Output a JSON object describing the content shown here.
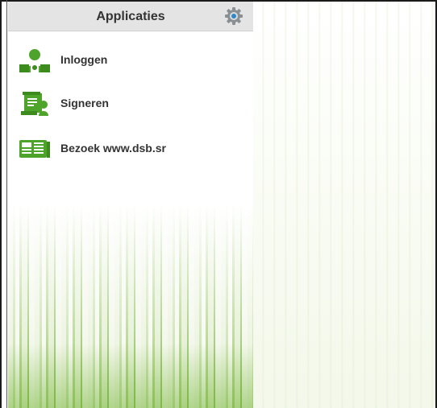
{
  "header": {
    "title": "Applicaties",
    "settings_icon": "gear-icon"
  },
  "menu": {
    "items": [
      {
        "label": "Inloggen",
        "icon": "user-login-icon"
      },
      {
        "label": "Signeren",
        "icon": "sign-document-icon"
      },
      {
        "label": "Bezoek www.dsb.sr",
        "icon": "newspaper-icon"
      }
    ]
  },
  "colors": {
    "accent": "#4ea32a",
    "header_bg": "#e4e4e4",
    "text": "#333333"
  }
}
